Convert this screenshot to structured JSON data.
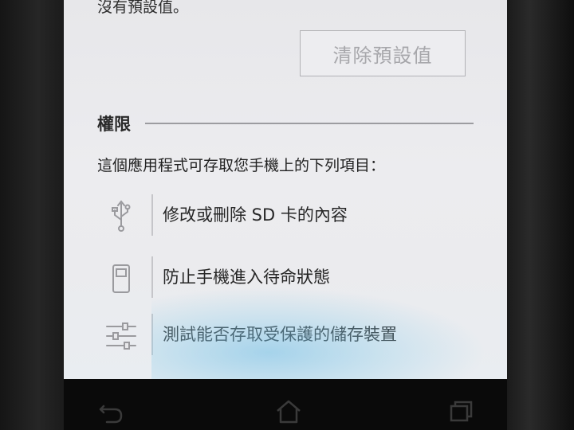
{
  "defaults": {
    "status_text": "沒有預設值。",
    "clear_button_label": "清除預設值"
  },
  "permissions": {
    "section_title": "權限",
    "description": "這個應用程式可存取您手機上的下列項目：",
    "items": [
      {
        "icon": "usb-storage-icon",
        "label": "修改或刪除 SD 卡的內容"
      },
      {
        "icon": "phone-device-icon",
        "label": "防止手機進入待命狀態"
      },
      {
        "icon": "settings-sliders-icon",
        "label": "測試能否存取受保護的儲存裝置"
      }
    ]
  },
  "navigation": {
    "buttons": [
      "back-icon",
      "home-icon",
      "recent-apps-icon"
    ]
  },
  "colors": {
    "screen_background": "#ececef",
    "text": "#262626",
    "disabled_text": "#a7a7ab",
    "divider": "#9c9ca0"
  }
}
